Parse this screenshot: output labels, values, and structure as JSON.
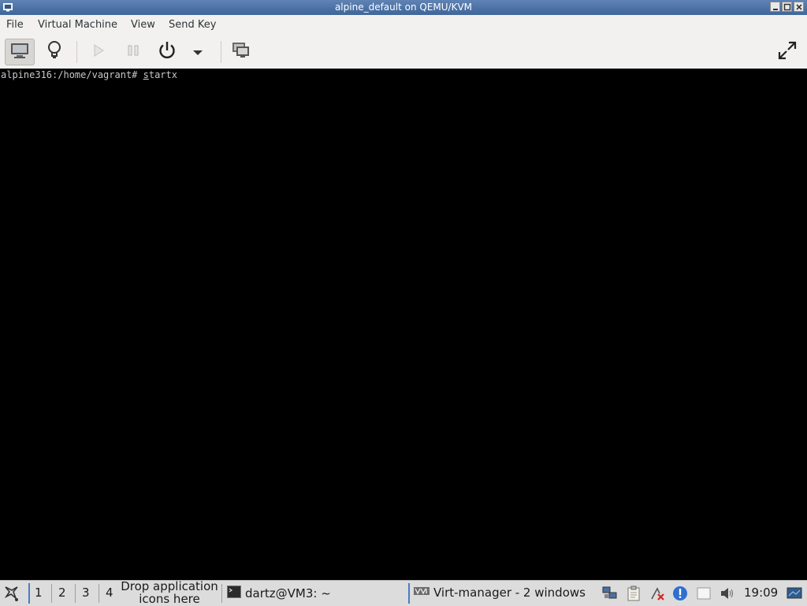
{
  "window": {
    "title": "alpine_default on QEMU/KVM"
  },
  "menu": {
    "items": [
      "File",
      "Virtual Machine",
      "View",
      "Send Key"
    ]
  },
  "toolbar": {
    "icons": [
      "console-icon",
      "details-icon",
      "run-icon",
      "pause-icon",
      "power-icon",
      "power-menu-icon",
      "snapshots-icon",
      "fullscreen-icon"
    ]
  },
  "console": {
    "prompt": "alpine316:/home/vagrant# ",
    "command_first": "s",
    "command_rest": "tartx"
  },
  "taskbar": {
    "workspaces": [
      "1",
      "2",
      "3",
      "4"
    ],
    "drop_text_line1": "Drop application",
    "drop_text_line2": "icons here",
    "tasks": [
      {
        "label": "dartz@VM3: ~"
      },
      {
        "label": "Virt-manager - 2 windows"
      }
    ],
    "clock": "19:09"
  },
  "colors": {
    "titlebar": "#4a70a6",
    "console_bg": "#000000",
    "accent": "#4a7cc4"
  }
}
